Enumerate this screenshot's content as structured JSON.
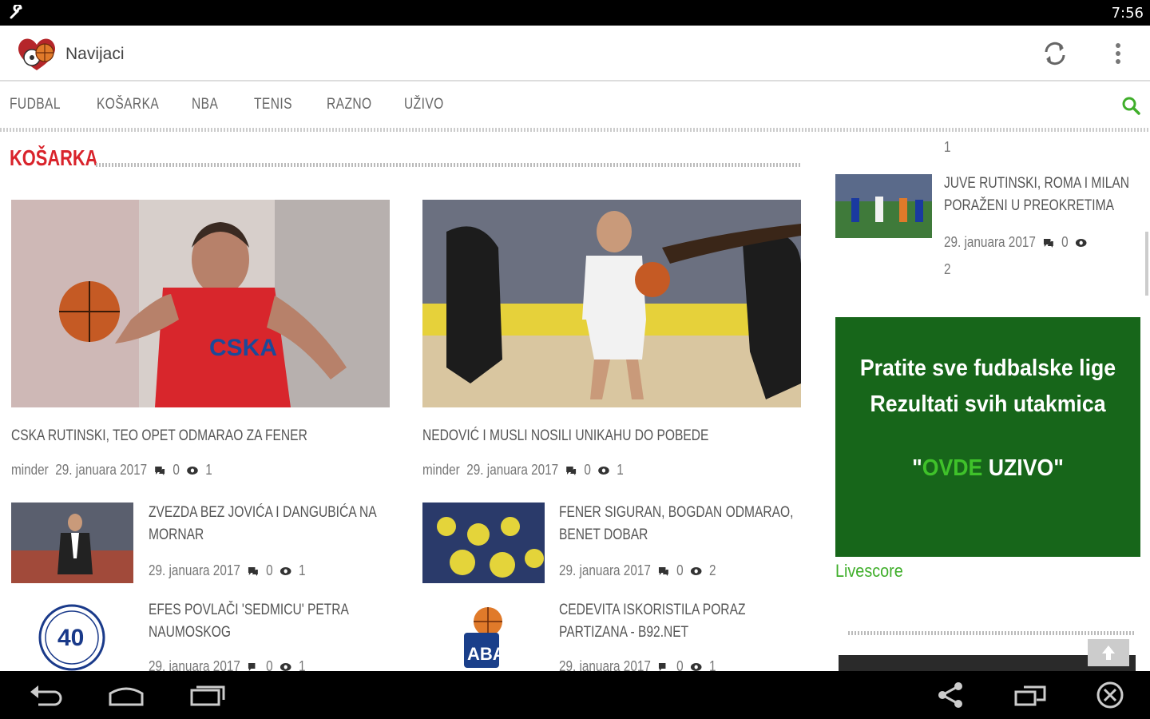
{
  "status": {
    "time": "7:56"
  },
  "app": {
    "title": "Navijaci"
  },
  "nav": {
    "tabs": [
      "FUDBAL",
      "KOŠARKA",
      "NBA",
      "TENIS",
      "RAZNO",
      "UŽIVO"
    ]
  },
  "section": {
    "title": "KOŠARKA"
  },
  "main_articles": [
    {
      "title": "CSKA RUTINSKI, TEO OPET ODMARAO ZA FENER",
      "author": "minder",
      "date": "29. januara 2017",
      "comments": "0",
      "views": "1"
    },
    {
      "title": "NEDOVIĆ I MUSLI NOSILI UNIKAHU DO POBEDE",
      "author": "minder",
      "date": "29. januara 2017",
      "comments": "0",
      "views": "1"
    }
  ],
  "small_articles": [
    {
      "title_line1": "ZVEZDA BEZ JOVIĆA I DANGUBIĆA NA",
      "title_line2": "MORNAR",
      "date": "29. januara 2017",
      "comments": "0",
      "views": "1"
    },
    {
      "title_line1": "FENER SIGURAN, BOGDAN ODMARAO,",
      "title_line2": "BENET DOBAR",
      "date": "29. januara 2017",
      "comments": "0",
      "views": "2"
    },
    {
      "title_line1": "EFES POVLAČI 'SEDMICU' PETRA",
      "title_line2": "NAUMOSKOG",
      "date": "29. januara 2017",
      "comments": "0",
      "views": "1"
    },
    {
      "title_line1": "CEDEVITA ISKORISTILA PORAZ",
      "title_line2": "PARTIZANA - B92.NET",
      "date": "29. januara 2017",
      "comments": "0",
      "views": "1"
    }
  ],
  "sidebar": {
    "top_count": "1",
    "article": {
      "title_line1": "JUVE RUTINSKI, ROMA I MILAN",
      "title_line2": "PORAŽENI U PREOKRETIMA",
      "date": "29. januara 2017",
      "comments": "0",
      "views": "2"
    },
    "ad": {
      "line1": "Pratite sve fudbalske lige",
      "line2": "Rezultati svih utakmica",
      "quote_open": "\"",
      "highlight": "OVDE",
      "rest": " UZIVO\""
    },
    "livescore": "Livescore"
  },
  "logos": {
    "aba": "ABA"
  },
  "colors": {
    "accent_red": "#d9232b",
    "ad_green": "#17661a",
    "link_green": "#3fae2a",
    "nav_search": "#3fae2a"
  },
  "icons": [
    "wrench-icon",
    "refresh-icon",
    "overflow-menu-icon",
    "search-icon",
    "comment-icon",
    "eye-icon",
    "arrow-up-icon",
    "back-icon",
    "home-icon",
    "recents-icon",
    "share-icon",
    "window-icon",
    "close-circle-icon"
  ]
}
